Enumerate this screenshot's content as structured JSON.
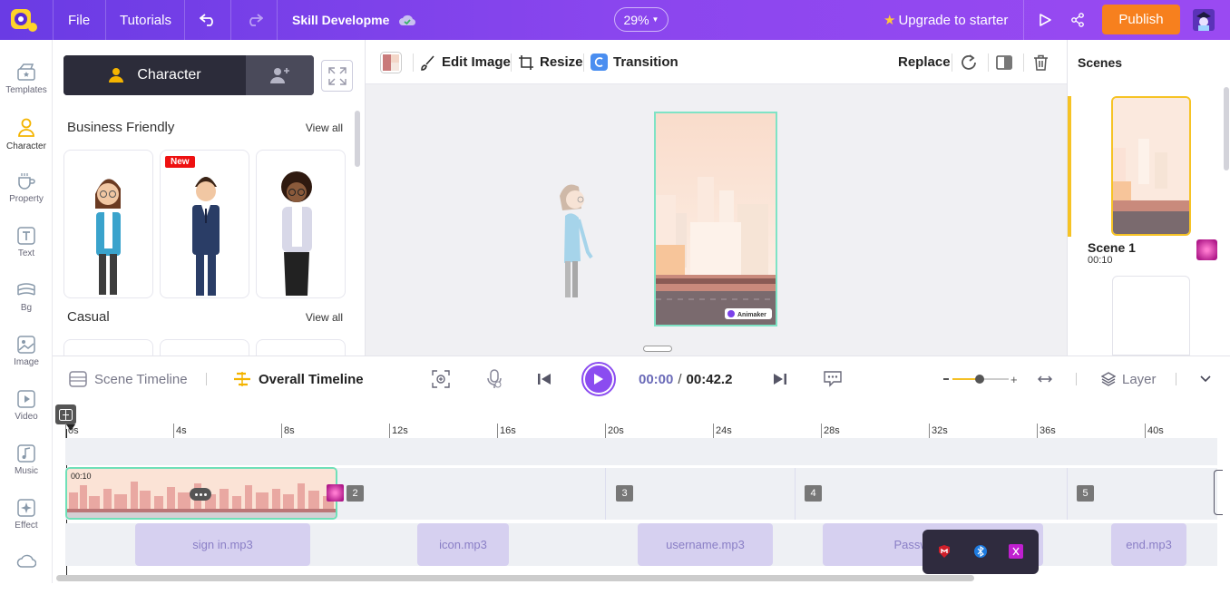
{
  "topbar": {
    "file": "File",
    "tutorials": "Tutorials",
    "project_name": "Skill Developme",
    "zoom": "29%",
    "upgrade": "Upgrade to starter",
    "publish": "Publish"
  },
  "leftnav": [
    {
      "label": "Templates",
      "icon": "templates-icon"
    },
    {
      "label": "Character",
      "icon": "character-icon"
    },
    {
      "label": "Property",
      "icon": "property-icon"
    },
    {
      "label": "Text",
      "icon": "text-icon"
    },
    {
      "label": "Bg",
      "icon": "bg-icon"
    },
    {
      "label": "Image",
      "icon": "image-icon"
    },
    {
      "label": "Video",
      "icon": "video-icon"
    },
    {
      "label": "Music",
      "icon": "music-icon"
    },
    {
      "label": "Effect",
      "icon": "effect-icon"
    }
  ],
  "panel": {
    "tab_character": "Character",
    "section1": "Business Friendly",
    "section2": "Casual",
    "view_all": "View all",
    "new_badge": "New"
  },
  "toolbar": {
    "edit_image": "Edit Image",
    "resize": "Resize",
    "transition": "Transition",
    "replace": "Replace"
  },
  "canvas": {
    "watermark": "Animaker"
  },
  "scenes": {
    "title": "Scenes",
    "scene1_name": "Scene 1",
    "scene1_duration": "00:10"
  },
  "timeline": {
    "scene_timeline": "Scene Timeline",
    "overall_timeline": "Overall Timeline",
    "current_time": "00:00",
    "separator": "/",
    "total_time": "00:42.2",
    "layer": "Layer",
    "ruler": [
      "0s",
      "4s",
      "8s",
      "12s",
      "16s",
      "20s",
      "24s",
      "28s",
      "32s",
      "36s",
      "40s"
    ],
    "clip1_duration": "00:10",
    "scene_numbers": [
      "2",
      "3",
      "4",
      "5"
    ],
    "audio_clips": [
      "sign in.mp3",
      "icon.mp3",
      "username.mp3",
      "Password.mp3",
      "end.mp3"
    ]
  },
  "colors": {
    "topbar": "#7b41ea",
    "publish": "#f7801e",
    "accent": "#8b4cf0",
    "selected": "#f6c325",
    "clip_border": "#6fe0b8"
  }
}
